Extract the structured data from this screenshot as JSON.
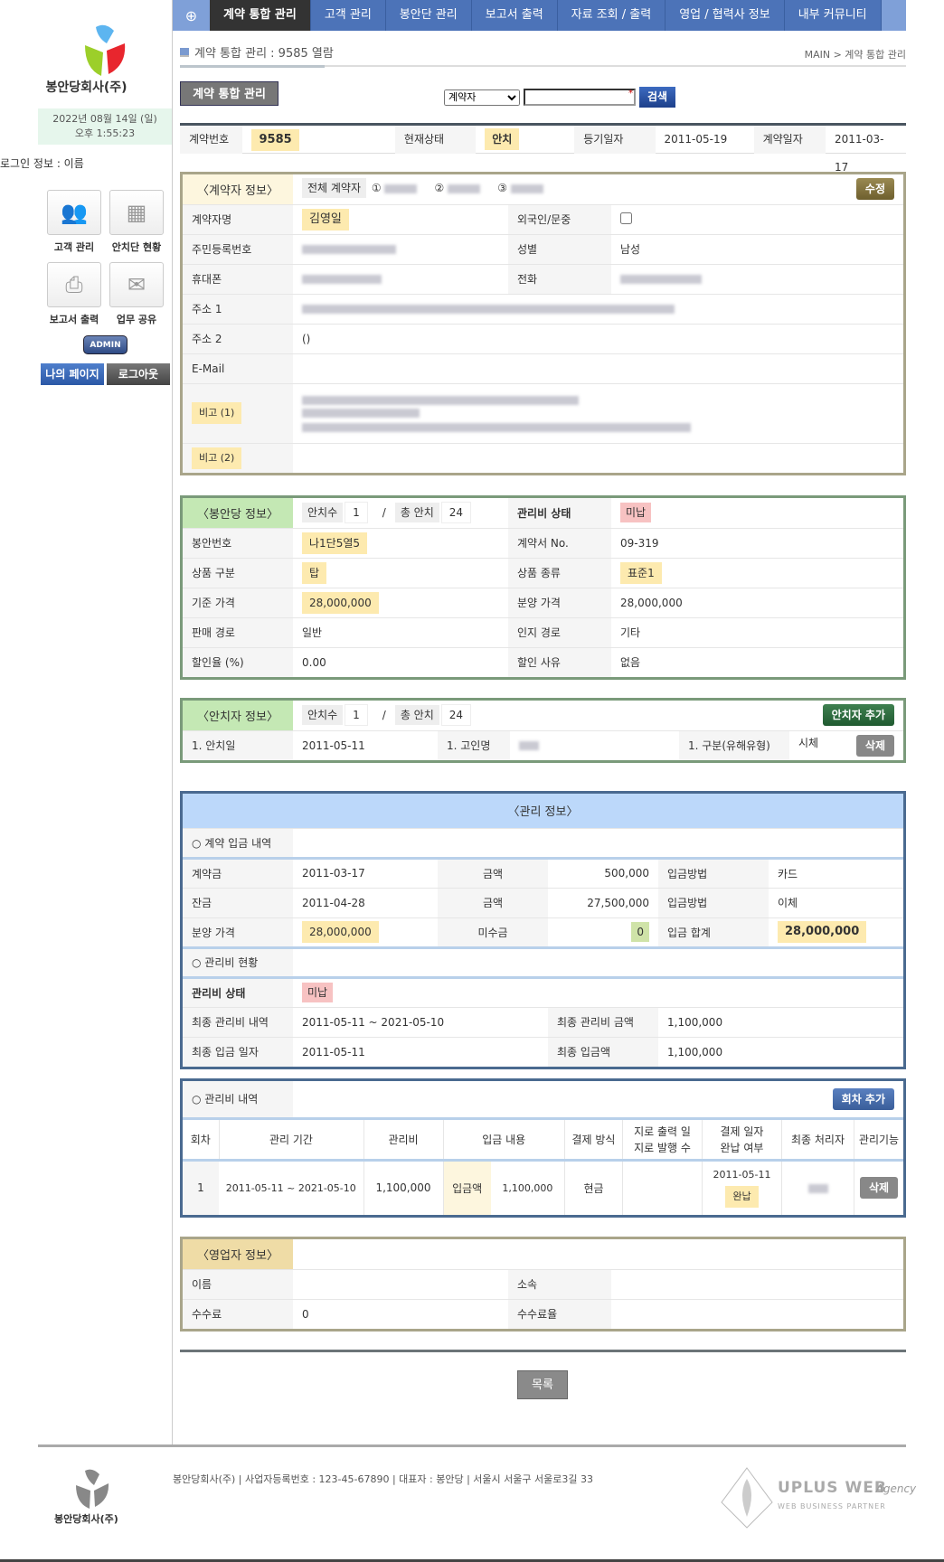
{
  "sidebar": {
    "company": "봉안당회사(주)",
    "date": "2022년  08월 14일 (일)",
    "time": "오후 1:55:23",
    "login_info": "로그인 정보 : 이름",
    "quick": [
      {
        "label": "고객 관리",
        "icon": "people-icon"
      },
      {
        "label": "안치단 현황",
        "icon": "grid-icon"
      },
      {
        "label": "보고서 출력",
        "icon": "printer-icon"
      },
      {
        "label": "업무 공유",
        "icon": "mail-icon"
      }
    ],
    "admin": "ADMIN",
    "mypage": "나의 페이지",
    "logout": "로그아웃"
  },
  "nav": {
    "items": [
      "계약 통합 관리",
      "고객 관리",
      "봉안단 관리",
      "보고서 출력",
      "자료 조회 / 출력",
      "영업 / 협력사 정보",
      "내부 커뮤니티"
    ],
    "active": 0
  },
  "page": {
    "title": "계약 통합 관리 : 9585 열람",
    "breadcrumb": "MAIN > 계약 통합 관리",
    "main_button": "계약 통합 관리"
  },
  "search": {
    "select": "계약자",
    "value": "",
    "required_mark": "*",
    "button": "검색"
  },
  "info": {
    "contract_no_label": "계약번호",
    "contract_no": "9585",
    "status_label": "현재상태",
    "status": "안치",
    "reg_label": "등기일자",
    "reg_date": "2011-05-19",
    "contract_date_label": "계약일자",
    "contract_date": "2011-03-17"
  },
  "contractor": {
    "title": "〈계약자 정보〉",
    "all_tab": "전체 계약자",
    "tabs": [
      "①",
      "②",
      "③"
    ],
    "edit": "수정",
    "name_label": "계약자명",
    "name": "김영일",
    "foreign_label": "외국인/문중",
    "foreign": false,
    "rrn_label": "주민등록번호",
    "gender_label": "성별",
    "gender": "남성",
    "mobile_label": "휴대폰",
    "phone_label": "전화",
    "addr1_label": "주소 1",
    "addr2_label": "주소 2",
    "addr2": "()",
    "email_label": "E-Mail",
    "email": "",
    "note1_label": "비고 (1)",
    "note2_label": "비고 (2)"
  },
  "bongan": {
    "title": "〈봉안당 정보〉",
    "count_label": "안치수",
    "count": "1",
    "sep": "/",
    "total_label": "총 안치",
    "total": "24",
    "fee_status_label": "관리비 상태",
    "fee_status": "미납",
    "rows": [
      [
        "봉안번호",
        "나1단5열5",
        "계약서 No.",
        "09-319"
      ],
      [
        "상품 구분",
        "탑",
        "상품 종류",
        "표준1"
      ],
      [
        "기준 가격",
        "28,000,000",
        "분양 가격",
        "28,000,000"
      ],
      [
        "판매 경로",
        "일반",
        "인지 경로",
        "기타"
      ],
      [
        "할인율 (%)",
        "0.00",
        "할인 사유",
        "없음"
      ]
    ]
  },
  "deceased": {
    "title": "〈안치자 정보〉",
    "count_label": "안치수",
    "count": "1",
    "sep": "/",
    "total_label": "총 안치",
    "total": "24",
    "add": "안치자 추가",
    "date_label": "1. 안치일",
    "date": "2011-05-11",
    "name_label": "1. 고인명",
    "type_label": "1. 구분(유해유형)",
    "type": "시체",
    "delete": "삭제"
  },
  "manage": {
    "title": "〈관리 정보〉",
    "payment_head": "○ 계약 입금 내역",
    "payments": [
      {
        "label": "계약금",
        "date": "2011-03-17",
        "amt_label": "금액",
        "amount": "500,000",
        "method_label": "입금방법",
        "method": "카드"
      },
      {
        "label": "잔금",
        "date": "2011-04-28",
        "amt_label": "금액",
        "amount": "27,500,000",
        "method_label": "입금방법",
        "method": "이체"
      }
    ],
    "price_label": "분양 가격",
    "price": "28,000,000",
    "unpaid_label": "미수금",
    "unpaid": "0",
    "sum_label": "입금 합계",
    "sum": "28,000,000",
    "fee_head": "○ 관리비 현황",
    "fee_status_label": "관리비 상태",
    "fee_status": "미납",
    "last_period_label": "최종 관리비 내역",
    "last_period": "2011-05-11 ~ 2021-05-10",
    "last_amount_label": "최종 관리비 금액",
    "last_amount": "1,100,000",
    "last_pay_date_label": "최종 입금 일자",
    "last_pay_date": "2011-05-11",
    "last_paid_label": "최종 입금액",
    "last_paid": "1,100,000"
  },
  "fees": {
    "head": "○ 관리비 내역",
    "add": "회차 추가",
    "columns": [
      "회차",
      "관리 기간",
      "관리비",
      "입금 내용",
      "결제 방식",
      "지로 출력 일",
      "지로 발행 수",
      "결제 일자",
      "완납 여부",
      "최종 처리자",
      "관리기능"
    ],
    "rows": [
      {
        "no": "1",
        "period": "2011-05-11 ~ 2021-05-10",
        "fee": "1,100,000",
        "paid_label": "입금액",
        "paid": "1,100,000",
        "method": "현금",
        "pay_date": "2011-05-11",
        "done": "완납",
        "delete": "삭제"
      }
    ]
  },
  "sales": {
    "title": "〈영업자 정보〉",
    "name_label": "이름",
    "name": "",
    "org_label": "소속",
    "org": "",
    "commission_label": "수수료",
    "commission": "0",
    "rate_label": "수수료율",
    "rate": ""
  },
  "list_button": "목록",
  "footer": {
    "company": "봉안당회사(주)",
    "text": "봉안당회사(주)  |  사업자등록번호 : 123-45-67890  |  대표자 : 봉안당  |  서울시 서울구 서울로3길 33",
    "partner": "UPLUS WEB",
    "partner_sub": "WEB BUSINESS PARTNER",
    "partner_script": ". Agency"
  },
  "colors": {
    "nav": "#4c73b8",
    "active_nav": "#333333",
    "highlight": "#fdeaaf",
    "unpaid": "#f7c2c2"
  }
}
